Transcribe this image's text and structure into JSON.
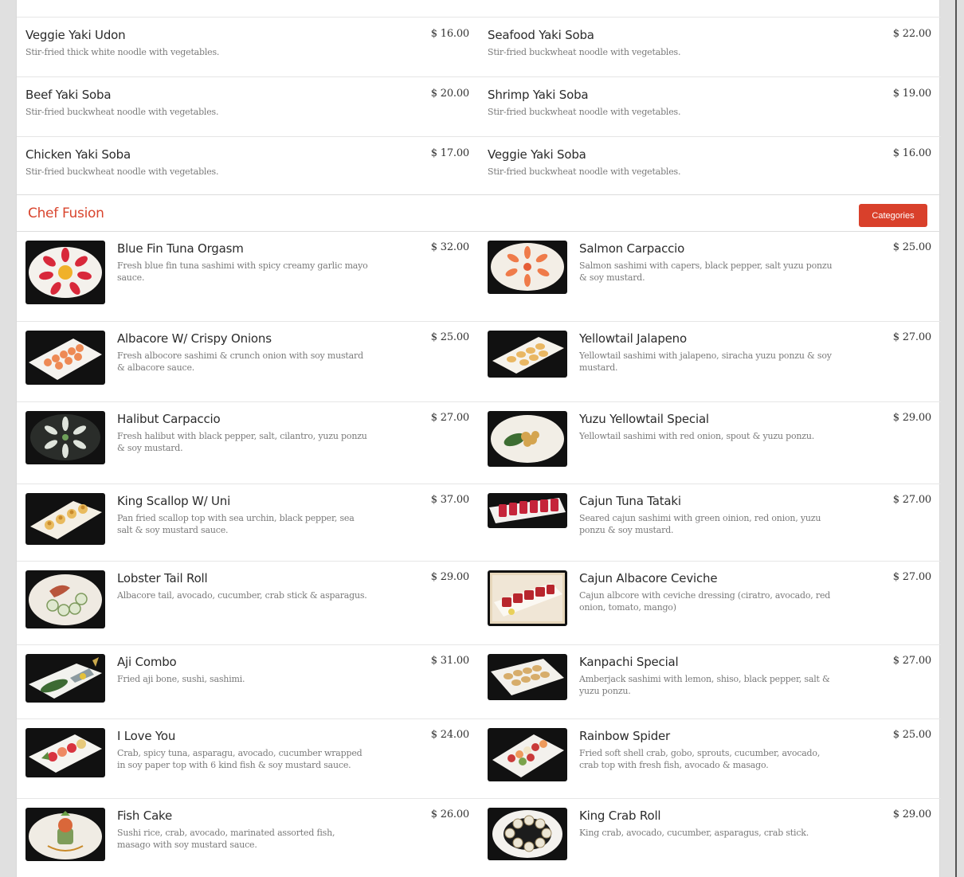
{
  "colors": {
    "accent": "#d9452e",
    "button_bg": "#d9402b",
    "price_text": "#333333",
    "description_text": "#7a7a7a"
  },
  "noodles": [
    {
      "left": {
        "name": "Veggie Yaki Udon",
        "price": "$ 16.00",
        "desc": "Stir-fried thick white noodle with vegetables."
      },
      "right": {
        "name": "Seafood Yaki Soba",
        "price": "$ 22.00",
        "desc": "Stir-fried buckwheat noodle with vegetables."
      }
    },
    {
      "left": {
        "name": "Beef Yaki Soba",
        "price": "$ 20.00",
        "desc": "Stir-fried buckwheat noodle with vegetables."
      },
      "right": {
        "name": "Shrimp Yaki Soba",
        "price": "$ 19.00",
        "desc": "Stir-fried buckwheat noodle with vegetables."
      }
    },
    {
      "left": {
        "name": "Chicken Yaki Soba",
        "price": "$ 17.00",
        "desc": "Stir-fried buckwheat noodle with vegetables."
      },
      "right": {
        "name": "Veggie Yaki Soba",
        "price": "$ 16.00",
        "desc": "Stir-fried buckwheat noodle with vegetables."
      }
    }
  ],
  "section": {
    "title": "Chef Fusion",
    "categories_label": "Categories"
  },
  "fusion": [
    {
      "left": {
        "name": "Blue Fin Tuna Orgasm",
        "price": "$ 32.00",
        "desc": "Fresh blue fin tuna sashimi with spicy creamy garlic mayo sauce.",
        "image": "round-plate-red-sashimi"
      },
      "right": {
        "name": "Salmon Carpaccio",
        "price": "$ 25.00",
        "desc": "Salmon sashimi with capers, black pepper, salt yuzu ponzu & soy mustard.",
        "image": "round-plate-salmon"
      }
    },
    {
      "left": {
        "name": "Albacore W/ Crispy Onions",
        "price": "$ 25.00",
        "desc": "Fresh albocore sashimi & crunch onion with soy mustard & albacore sauce.",
        "image": "square-plate-albacore"
      },
      "right": {
        "name": "Yellowtail Jalapeno",
        "price": "$ 27.00",
        "desc": "Yellowtail sashimi with jalapeno, siracha yuzu ponzu & soy mustard.",
        "image": "square-plate-yellowtail"
      }
    },
    {
      "left": {
        "name": "Halibut Carpaccio",
        "price": "$ 27.00",
        "desc": "Fresh halibut with black pepper, salt, cilantro, yuzu ponzu & soy mustard.",
        "image": "dark-plate-halibut"
      },
      "right": {
        "name": "Yuzu Yellowtail Special",
        "price": "$ 29.00",
        "desc": "Yellowtail sashimi with red onion, spout & yuzu ponzu.",
        "image": "round-plate-yellowtail"
      }
    },
    {
      "left": {
        "name": "King Scallop W/ Uni",
        "price": "$ 37.00",
        "desc": "Pan fried scallop top with sea urchin, black pepper, sea salt & soy mustard sauce.",
        "image": "square-plate-scallop"
      },
      "right": {
        "name": "Cajun Tuna Tataki",
        "price": "$ 27.00",
        "desc": "Seared cajun sashimi with green oinion, red onion, yuzu ponzu & soy mustard.",
        "image": "long-plate-tuna"
      }
    },
    {
      "left": {
        "name": "Lobster Tail Roll",
        "price": "$ 29.00",
        "desc": "Albacore tail, avocado, cucumber, crab stick & asparagus.",
        "image": "round-plate-roll"
      },
      "right": {
        "name": "Cajun Albacore Ceviche",
        "price": "$ 27.00",
        "desc": "Cajun albcore with ceviche dressing (ciratro, avocado, red onion, tomato, mango)",
        "image": "framed-ceviche"
      }
    },
    {
      "left": {
        "name": "Aji Combo",
        "price": "$ 31.00",
        "desc": "Fried aji bone, sushi, sashimi.",
        "image": "square-plate-aji"
      },
      "right": {
        "name": "Kanpachi Special",
        "price": "$ 27.00",
        "desc": "Amberjack sashimi with lemon, shiso, black pepper, salt & yuzu ponzu.",
        "image": "square-plate-kanpachi"
      }
    },
    {
      "left": {
        "name": "I Love You",
        "price": "$ 24.00",
        "desc": "Crab, spicy tuna, asparagu, avocado, cucumber wrapped in soy paper top with 6 kind fish & soy mustard sauce.",
        "image": "square-plate-roll"
      },
      "right": {
        "name": "Rainbow Spider",
        "price": "$ 25.00",
        "desc": "Fried soft shell crab, gobo, sprouts, cucumber, avocado, crab top with fresh fish, avocado & masago.",
        "image": "square-plate-rainbow"
      }
    },
    {
      "left": {
        "name": "Fish Cake",
        "price": "$ 26.00",
        "desc": "Sushi rice, crab, avocado, marinated assorted fish, masago with soy mustard sauce.",
        "image": "round-plate-tower"
      },
      "right": {
        "name": "King Crab Roll",
        "price": "$ 29.00",
        "desc": "King crab, avocado, cucumber, asparagus, crab stick.",
        "image": "round-plate-crab"
      }
    }
  ]
}
